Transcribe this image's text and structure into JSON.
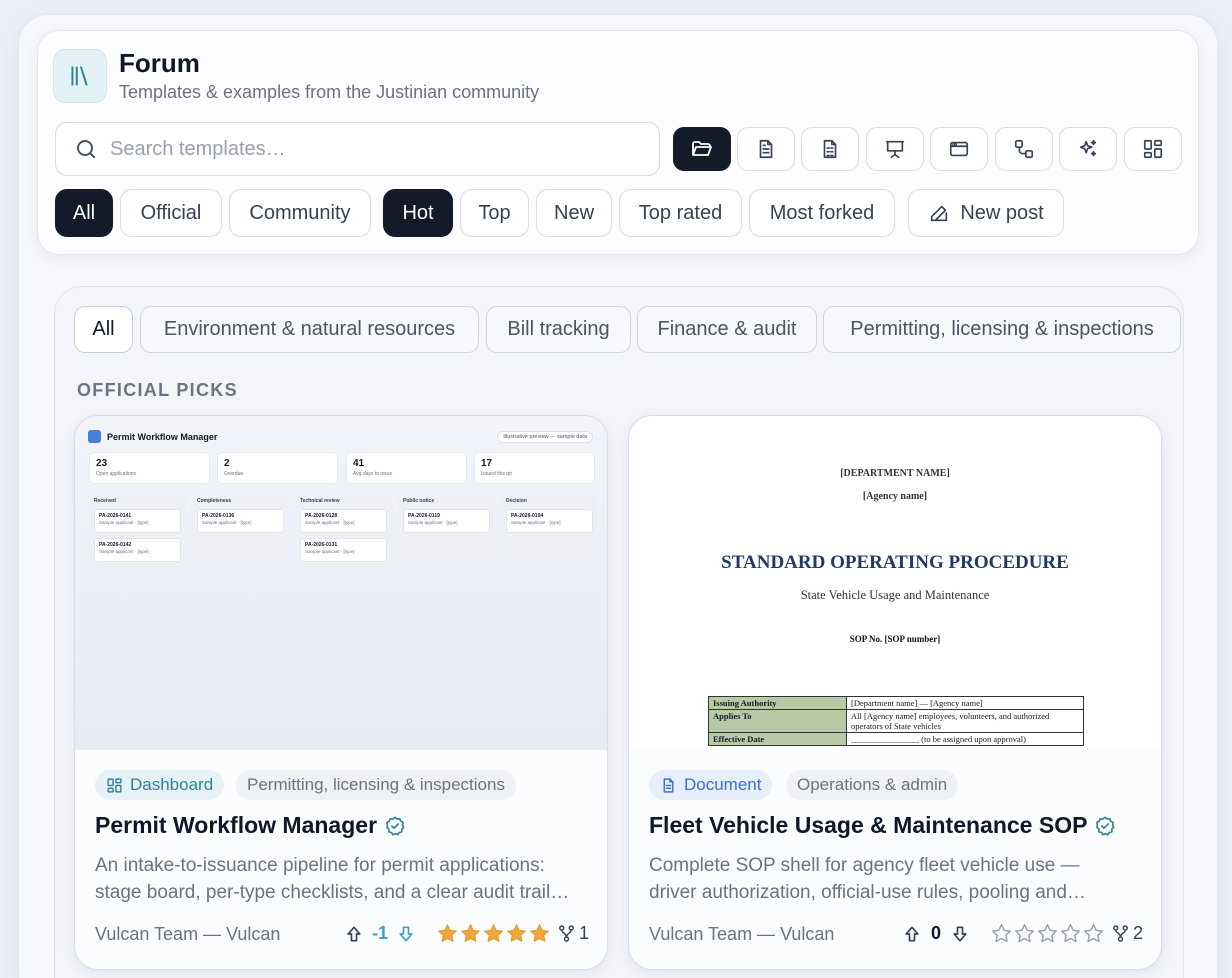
{
  "header": {
    "title": "Forum",
    "subtitle": "Templates & examples from the Justinian community",
    "search_placeholder": "Search templates…",
    "type_filters": [
      {
        "icon": "folder-open-icon",
        "active": true
      },
      {
        "icon": "document-icon",
        "active": false
      },
      {
        "icon": "spreadsheet-document-icon",
        "active": false
      },
      {
        "icon": "presentation-icon",
        "active": false
      },
      {
        "icon": "browser-window-icon",
        "active": false
      },
      {
        "icon": "workflow-icon",
        "active": false
      },
      {
        "icon": "sparkles-icon",
        "active": false
      },
      {
        "icon": "dashboard-grid-icon",
        "active": false
      }
    ],
    "source_filters": [
      "All",
      "Official",
      "Community"
    ],
    "sort_filters": [
      "Hot",
      "Top",
      "New",
      "Top rated",
      "Most forked"
    ],
    "new_post_label": "New post"
  },
  "categories": [
    "All",
    "Environment & natural resources",
    "Bill tracking",
    "Finance & audit",
    "Permitting, licensing & inspections"
  ],
  "section_title": "OFFICIAL PICKS",
  "cards": [
    {
      "type_label": "Dashboard",
      "category": "Permitting, licensing & inspections",
      "title": "Permit Workflow Manager",
      "description": "An intake-to-issuance pipeline for permit applications: stage board, per-type checklists, and a clear audit trail for every decision.",
      "author": "Vulcan Team — Vulcan",
      "votes": "-1",
      "rating": 5,
      "forks": "1",
      "preview": {
        "title": "Permit Workflow Manager",
        "badge": "Illustrative preview — sample data",
        "stats": [
          {
            "value": "23",
            "label": "Open applications"
          },
          {
            "value": "2",
            "label": "Overdue"
          },
          {
            "value": "41",
            "label": "Avg days to issue"
          },
          {
            "value": "17",
            "label": "Issued this qtr"
          }
        ],
        "columns": [
          {
            "name": "Received",
            "items": [
              {
                "id": "PA-2026-0141",
                "sub": "Sample applicant · [type]"
              },
              {
                "id": "PA-2026-0142",
                "sub": "Sample applicant · [type]"
              }
            ]
          },
          {
            "name": "Completeness",
            "items": [
              {
                "id": "PA-2026-0136",
                "sub": "Sample applicant · [type]"
              }
            ]
          },
          {
            "name": "Technical review",
            "items": [
              {
                "id": "PA-2026-0128",
                "sub": "Sample applicant · [type]"
              },
              {
                "id": "PA-2026-0131",
                "sub": "Sample applicant · [type]"
              }
            ]
          },
          {
            "name": "Public notice",
            "items": [
              {
                "id": "PA-2026-0119",
                "sub": "Sample applicant · [type]"
              }
            ]
          },
          {
            "name": "Decision",
            "items": [
              {
                "id": "PA-2026-0104",
                "sub": "Sample applicant · [type]"
              }
            ]
          }
        ]
      }
    },
    {
      "type_label": "Document",
      "category": "Operations & admin",
      "title": "Fleet Vehicle Usage & Maintenance SOP",
      "description": "Complete SOP shell for agency fleet vehicle use — driver authorization, official-use rules, pooling and maintenance schedules.",
      "author": "Vulcan Team — Vulcan",
      "votes": "0",
      "rating": 0,
      "forks": "2",
      "preview": {
        "dept": "[DEPARTMENT NAME]",
        "agency": "[Agency name]",
        "heading": "STANDARD OPERATING PROCEDURE",
        "subheading": "State Vehicle Usage and Maintenance",
        "sop_no": "SOP No. [SOP number]",
        "rows": [
          {
            "k": "Issuing Authority",
            "v": "[Department name] — [Agency name]"
          },
          {
            "k": "Applies To",
            "v": "All [Agency name] employees, volunteers, and authorized operators of State vehicles"
          },
          {
            "k": "Effective Date",
            "v": "________________ (to be assigned upon approval)"
          }
        ]
      }
    }
  ],
  "colors": {
    "dark": "#131a2a",
    "teal": "#2c8399",
    "blue": "#3b6fd1",
    "star": "#f0a63a"
  }
}
